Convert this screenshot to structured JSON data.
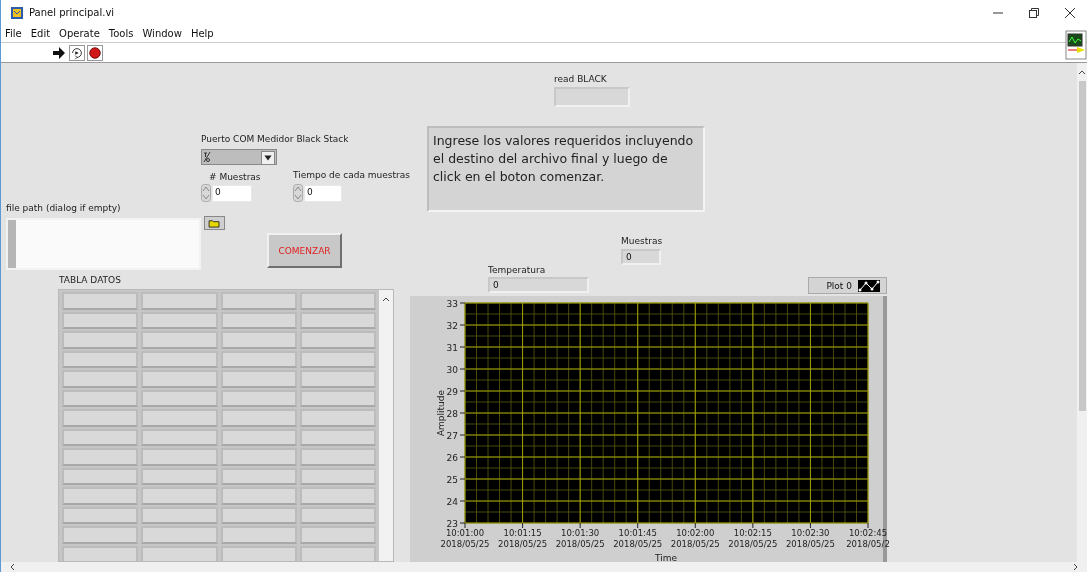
{
  "window": {
    "title": "Panel principal.vi"
  },
  "menu": [
    "File",
    "Edit",
    "Operate",
    "Tools",
    "Window",
    "Help"
  ],
  "read_black": {
    "label": "read BLACK"
  },
  "message": "Ingrese los valores requeridos incluyendo el destino del archivo final y  luego de click en el boton comenzar.",
  "com_port": {
    "label": "Puerto COM Medidor Black Stack"
  },
  "muestras_input": {
    "label": "# Muestras",
    "value": "0"
  },
  "tiempo_input": {
    "label": "Tiempo de cada muestras",
    "value": "0"
  },
  "file_path": {
    "label": "file path (dialog if empty)"
  },
  "start_button": "COMENZAR",
  "muestras_indicator": {
    "label": "Muestras",
    "value": "0"
  },
  "temperatura_indicator": {
    "label": "Temperatura",
    "value": "0"
  },
  "table": {
    "label": "TABLA DATOS"
  },
  "graph": {
    "legend": "Plot 0",
    "chart_data": {
      "type": "line",
      "xlabel": "Time",
      "ylabel": "Amplitude",
      "ylim": [
        23,
        33
      ],
      "grid": true,
      "yticks": [
        {
          "value": 23,
          "label": "23"
        },
        {
          "value": 24,
          "label": "24"
        },
        {
          "value": 25,
          "label": "25"
        },
        {
          "value": 26,
          "label": "26"
        },
        {
          "value": 27,
          "label": "27"
        },
        {
          "value": 28,
          "label": "28"
        },
        {
          "value": 29,
          "label": "29"
        },
        {
          "value": 30,
          "label": "30"
        },
        {
          "value": 31,
          "label": "31"
        },
        {
          "value": 32,
          "label": "32"
        },
        {
          "value": 33,
          "label": "33"
        }
      ],
      "categories": [
        "10:01:00 2018/05/25",
        "10:01:15 2018/05/25",
        "10:01:30 2018/05/25",
        "10:01:45 2018/05/25",
        "10:02:00 2018/05/25",
        "10:02:15 2018/05/25",
        "10:02:30 2018/05/25",
        "10:02:45 2018/05/2"
      ]
    }
  }
}
